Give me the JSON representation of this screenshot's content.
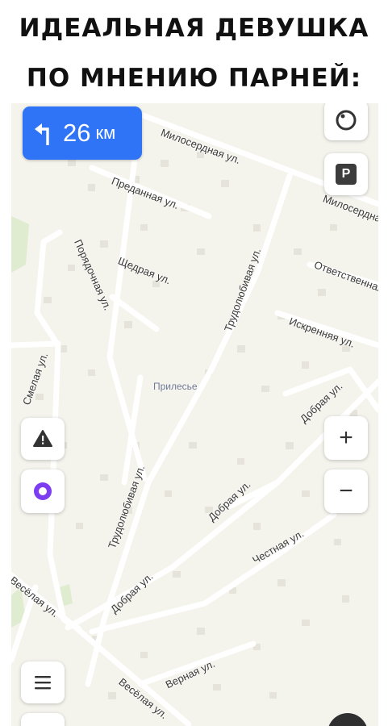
{
  "caption": {
    "line1": "ИДЕАЛЬНАЯ ДЕВУШКА",
    "line2": "ПО МНЕНИЮ ПАРНЕЙ:"
  },
  "route": {
    "distance": "26",
    "unit": "км",
    "color": "#2f74f6"
  },
  "map": {
    "locality": "Прилесье",
    "streets": [
      "Милосердная ул.",
      "Милосердная ул.",
      "Преданная ул.",
      "Щедрая ул.",
      "Порядочная ул.",
      "Трудолюбивая ул.",
      "Трудолюбивая ул.",
      "Ответственная ул.",
      "Искренняя ул.",
      "Смелая ул.",
      "Добрая ул.",
      "Добрая ул.",
      "Добрая ул.",
      "Честная ул.",
      "Весёлая ул.",
      "Весёлая ул.",
      "Верная ул."
    ]
  },
  "controls": {
    "parking": "P",
    "zoom_in": "+",
    "zoom_out": "−",
    "alice_color": "#7c3cf0"
  }
}
